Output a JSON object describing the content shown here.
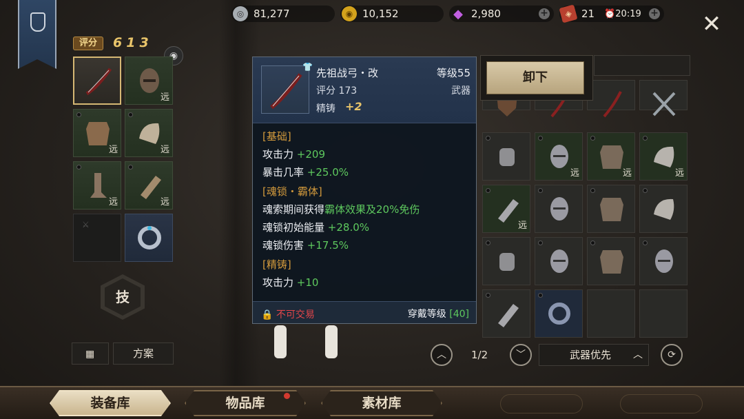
{
  "currencies": [
    {
      "name": "silver",
      "icon": "silver-coin-icon",
      "value": "81,277",
      "color": "#9aa0a6"
    },
    {
      "name": "gold",
      "icon": "gold-coin-icon",
      "value": "10,152",
      "color": "#d3a21c"
    },
    {
      "name": "gem",
      "icon": "diamond-icon",
      "value": "2,980",
      "color": "#b24fd6"
    },
    {
      "name": "stamina",
      "icon": "ticket-icon",
      "value": "21",
      "timer": "20:19",
      "color": "#c23a2a"
    }
  ],
  "score": {
    "label": "评分",
    "value": "613"
  },
  "left_slots": [
    {
      "name": "bow",
      "far": ""
    },
    {
      "name": "helmet",
      "far": "远"
    },
    {
      "name": "chest",
      "far": "远"
    },
    {
      "name": "shoulder",
      "far": "远"
    },
    {
      "name": "boots",
      "far": "远"
    },
    {
      "name": "gloves",
      "far": "远"
    },
    {
      "name": "empty",
      "far": ""
    },
    {
      "name": "ring",
      "far": ""
    }
  ],
  "skill_label": "技",
  "plan_label": "方案",
  "tooltip": {
    "name": "先祖战弓・改",
    "level": "等级55",
    "score": "评分 173",
    "type": "武器",
    "forge_label": "精铸",
    "forge_value": "+2",
    "sections": {
      "basic_title": "[基础]",
      "attack_label": "攻击力",
      "attack_val": "+209",
      "crit_label": "暴击几率",
      "crit_val": "+25.0%",
      "soul_title": "[魂锁・霸体]",
      "soul_line1_a": "魂索期间获得",
      "soul_line1_b": "霸体效果及20%免伤",
      "soul_energy_label": "魂锁初始能量",
      "soul_energy_val": "+28.0%",
      "soul_dmg_label": "魂锁伤害",
      "soul_dmg_val": "+17.5%",
      "forge_title": "[精铸]",
      "forge_attack_label": "攻击力",
      "forge_attack_val": "+10"
    },
    "untradeable": "不可交易",
    "wear_label": "穿戴等级",
    "wear_value": "[40]"
  },
  "unequip_label": "卸下",
  "inventory": [
    {
      "name": "shield",
      "far": ""
    },
    {
      "name": "bow",
      "far": ""
    },
    {
      "name": "bow",
      "far": ""
    },
    {
      "name": "swords",
      "far": ""
    },
    {
      "name": "bracer",
      "far": ""
    },
    {
      "name": "helmet",
      "far": "远"
    },
    {
      "name": "chest",
      "far": "远"
    },
    {
      "name": "shoulder",
      "far": "远"
    },
    {
      "name": "gauntlet",
      "far": "远"
    },
    {
      "name": "helmet",
      "far": ""
    },
    {
      "name": "chest",
      "far": ""
    },
    {
      "name": "shoulder",
      "far": ""
    },
    {
      "name": "bracer",
      "far": ""
    },
    {
      "name": "helmet",
      "far": ""
    },
    {
      "name": "chest",
      "far": ""
    },
    {
      "name": "helmet",
      "far": ""
    },
    {
      "name": "gauntlet",
      "far": ""
    },
    {
      "name": "ring",
      "far": ""
    },
    {
      "name": "empty",
      "far": ""
    },
    {
      "name": "empty",
      "far": ""
    }
  ],
  "pagination": {
    "text": "1/2"
  },
  "sort": {
    "label": "武器优先"
  },
  "tabs": [
    {
      "label": "装备库",
      "active": true
    },
    {
      "label": "物品库",
      "active": false
    },
    {
      "label": "素材库",
      "active": false
    }
  ]
}
